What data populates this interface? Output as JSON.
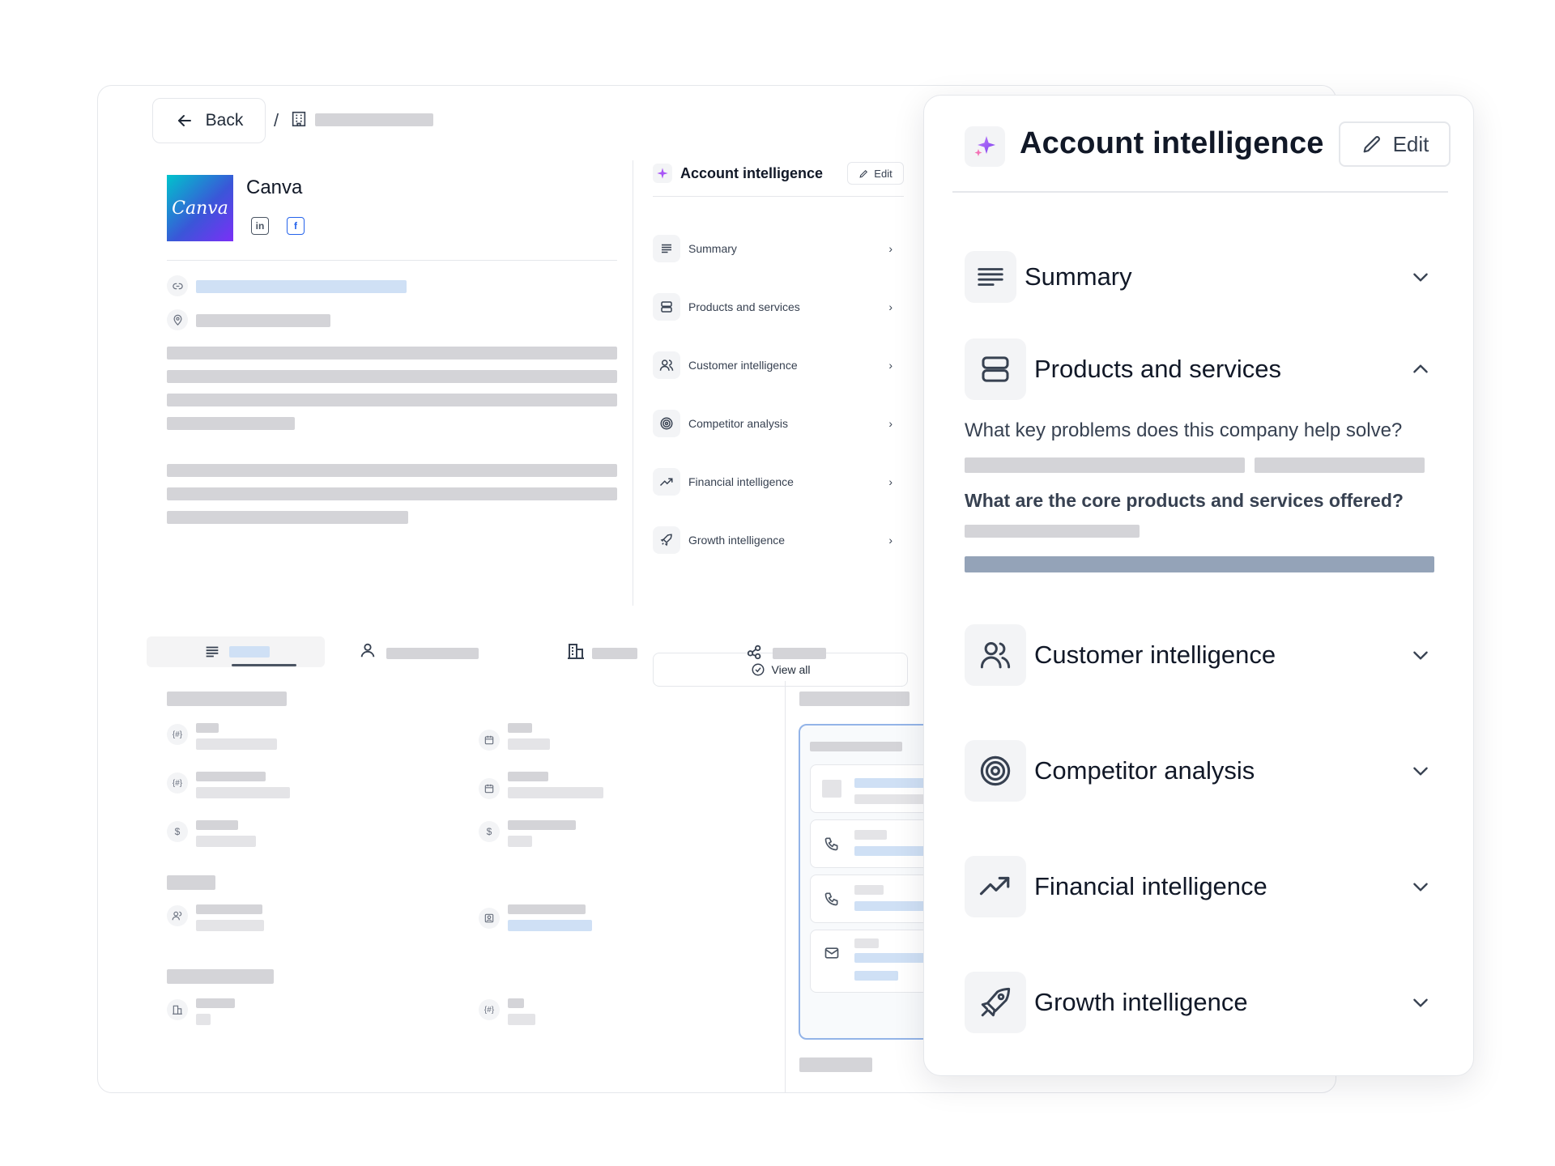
{
  "breadcrumb": {
    "back_label": "Back",
    "separator": "/"
  },
  "company": {
    "name": "Canva",
    "logo_text": "Canva"
  },
  "mini_panel": {
    "title": "Account intelligence",
    "edit_label": "Edit",
    "items": [
      {
        "label": "Summary",
        "icon": "summary-lines-icon"
      },
      {
        "label": "Products and services",
        "icon": "stack-icon"
      },
      {
        "label": "Customer intelligence",
        "icon": "users-icon"
      },
      {
        "label": "Competitor analysis",
        "icon": "target-icon"
      },
      {
        "label": "Financial intelligence",
        "icon": "trend-up-icon"
      },
      {
        "label": "Growth intelligence",
        "icon": "rocket-icon"
      }
    ],
    "view_all_label": "View all"
  },
  "panel": {
    "title": "Account intelligence",
    "edit_label": "Edit",
    "sections": [
      {
        "label": "Summary",
        "icon": "summary-lines-icon",
        "state": "collapsed"
      },
      {
        "label": "Products and services",
        "icon": "stack-icon",
        "state": "expanded"
      },
      {
        "label": "Customer intelligence",
        "icon": "users-icon",
        "state": "collapsed"
      },
      {
        "label": "Competitor analysis",
        "icon": "target-icon",
        "state": "collapsed"
      },
      {
        "label": "Financial intelligence",
        "icon": "trend-up-icon",
        "state": "collapsed"
      },
      {
        "label": "Growth intelligence",
        "icon": "rocket-icon",
        "state": "collapsed"
      }
    ],
    "questions": [
      "What key problems does this company help solve?",
      "What are the core products and services offered?"
    ]
  },
  "colors": {
    "accent": "#7c3aed",
    "spark": "#a855f7",
    "skeleton": "#d4d4d8",
    "skeleton_blue": "#cfe0f5",
    "progress": "#94a3b8"
  }
}
